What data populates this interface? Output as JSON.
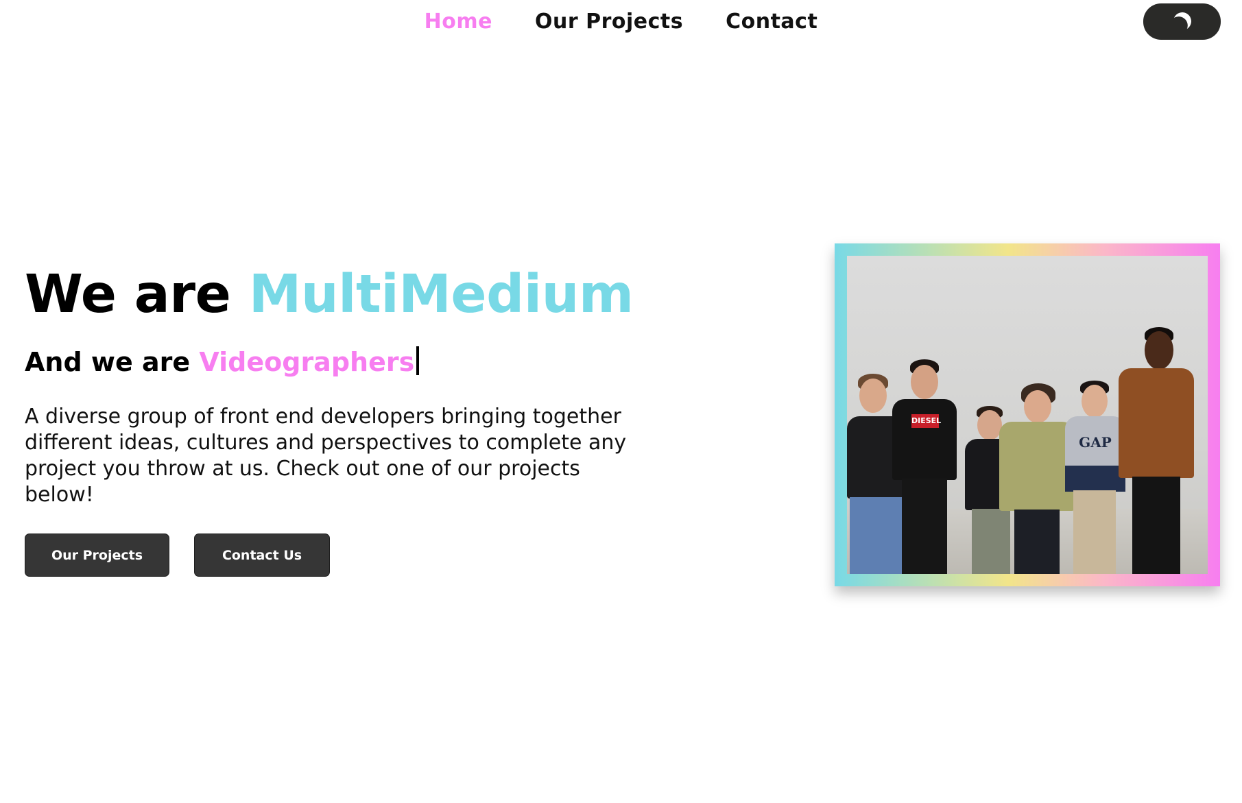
{
  "nav": {
    "links": [
      {
        "label": "Home",
        "active": true
      },
      {
        "label": "Our Projects",
        "active": false
      },
      {
        "label": "Contact",
        "active": false
      }
    ],
    "theme_toggle": {
      "icon": "moon-icon"
    }
  },
  "hero": {
    "title_prefix": "We are",
    "brand": "MultiMedium",
    "subtitle_prefix": "And we are",
    "role": "Videographers",
    "description": "A diverse group of front end developers bringing together different ideas, cultures and perspectives to complete any project you throw at us. Check out one of our projects below!",
    "buttons": {
      "projects": "Our Projects",
      "contact": "Contact Us"
    }
  },
  "colors": {
    "accent_pink": "#f77ef0",
    "accent_cyan": "#78d9e6",
    "button_bg": "#363636",
    "toggle_bg": "#2a2a28"
  },
  "photo": {
    "shirt_print_1": "DIESEL",
    "shirt_print_2": "GAP"
  }
}
